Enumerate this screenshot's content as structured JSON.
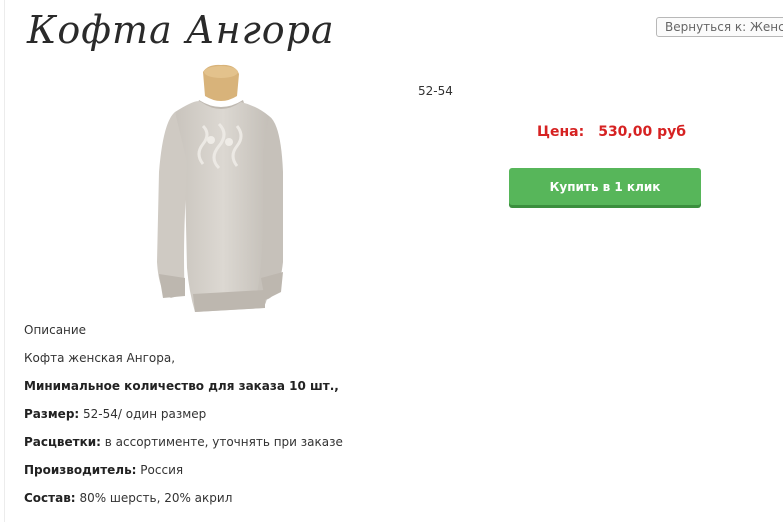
{
  "page": {
    "title": "Кофта Ангора",
    "back_link": "Вернуться к: Женская одежда"
  },
  "product": {
    "size": "52-54",
    "price_label": "Цена:",
    "price_value": "530,00 руб",
    "buy_button_label": "Купить в 1 клик",
    "image_icon": "sweater-on-mannequin",
    "colors": {
      "price": "#d62222",
      "button": "#57b65a",
      "button_shadow": "#3b8f3e"
    }
  },
  "description": {
    "heading": "Описание",
    "intro": "Кофта женская Ангора,",
    "min_order": "Минимальное количество для заказа 10 шт.,",
    "size_label": "Размер:",
    "size_value": "52-54/ один размер",
    "colors_label": "Расцветки:",
    "colors_value": "в ассортименте, уточнять при заказе",
    "maker_label": "Производитель:",
    "maker_value": "Россия",
    "composition_label": "Состав:",
    "composition_value": "80% шерсть, 20% акрил"
  }
}
